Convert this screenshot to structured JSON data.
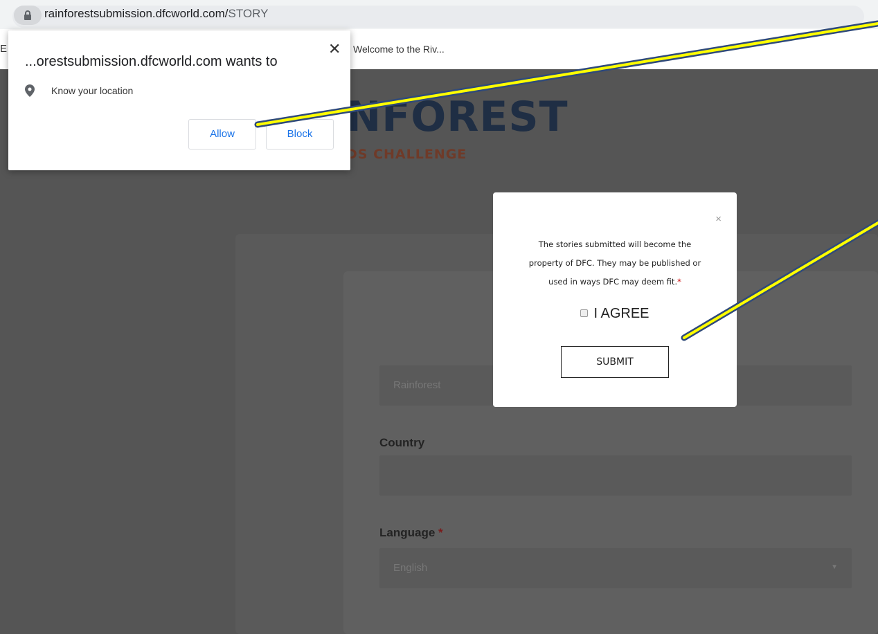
{
  "browser": {
    "url_host": "rainforestsubmission.dfcworld.com/",
    "url_path": "STORY",
    "bookmark_first": "E",
    "bookmark_item": "Welcome to the Riv..."
  },
  "permission_popup": {
    "title": "...orestsubmission.dfcworld.com wants to",
    "permission": "Know your location",
    "allow_label": "Allow",
    "block_label": "Block",
    "close_label": "✕"
  },
  "logo": {
    "main": "NFOREST",
    "sub": "DS CHALLENGE"
  },
  "form": {
    "first_field_value": "Rainforest",
    "country_label": "Country",
    "country_value": "",
    "language_label": "Language",
    "required_mark": "*",
    "language_value": "English",
    "select_caret": "▼"
  },
  "terms_modal": {
    "close_label": "×",
    "line1": "The stories submitted will become the",
    "line2": "property of DFC. They may be published or",
    "line3": "used in ways DFC may deem fit.",
    "required_mark": "*",
    "agree_label": "I AGREE",
    "agree_checked": false,
    "submit_label": "SUBMIT"
  },
  "colors": {
    "annotation_line": "#ffff00",
    "annotation_border": "#2f4a7a",
    "permission_button_text": "#1a73e8"
  }
}
